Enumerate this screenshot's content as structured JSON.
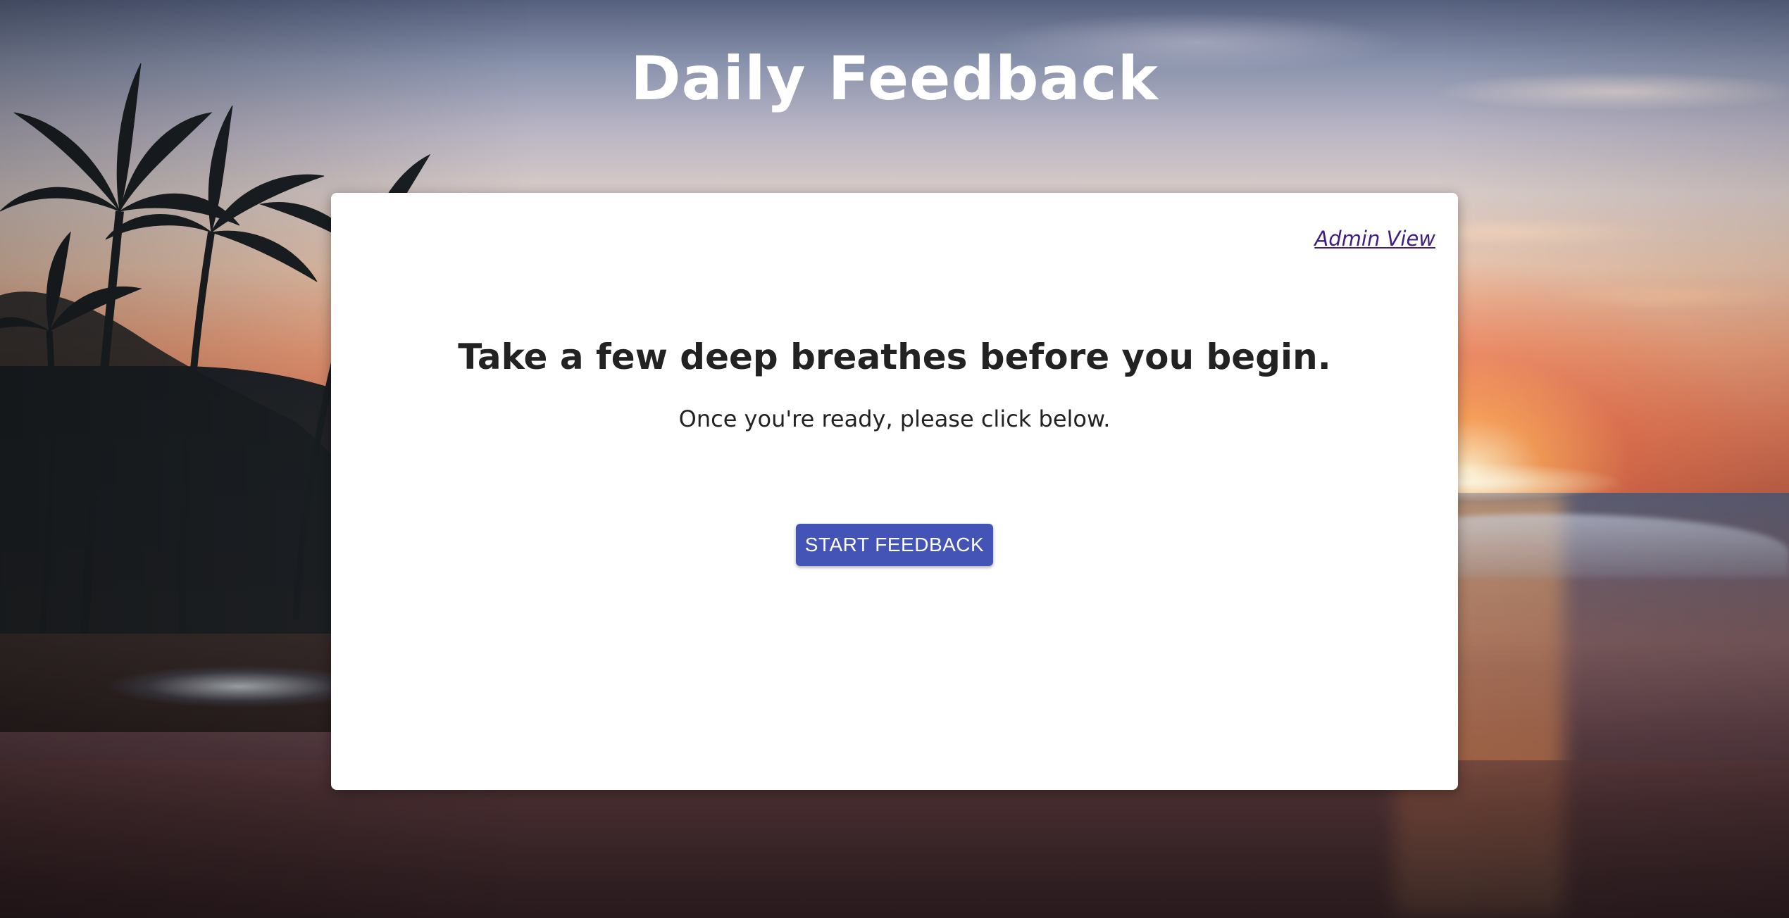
{
  "header": {
    "title": "Daily Feedback"
  },
  "card": {
    "admin_link_label": "Admin View",
    "headline": "Take a few deep breathes before you begin.",
    "subline": "Once you're ready, please click below.",
    "start_button_label": "START FEEDBACK"
  },
  "colors": {
    "button": "#4353b6",
    "link": "#3f1d82",
    "card": "#ffffff",
    "heading_text": "#222222"
  },
  "background": {
    "icon": "sunset-beach-background"
  }
}
